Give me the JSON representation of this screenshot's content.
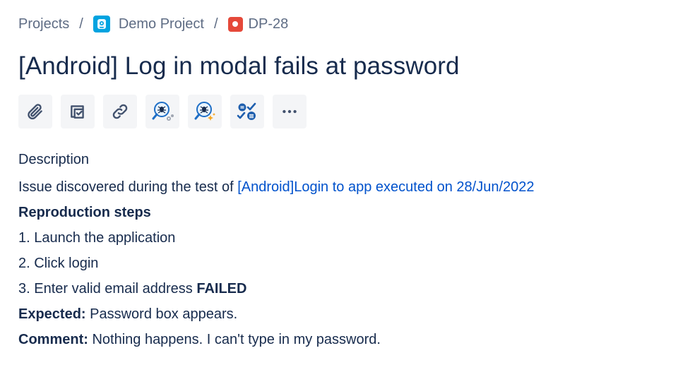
{
  "breadcrumb": {
    "projects": "Projects",
    "separator": "/",
    "project_name": "Demo Project",
    "issue_key": "DP-28"
  },
  "issue": {
    "title": "[Android] Log in modal fails at password"
  },
  "toolbar": {
    "buttons": [
      {
        "name": "attach",
        "icon": "paperclip-icon"
      },
      {
        "name": "add-child-issue",
        "icon": "checkbox-icon"
      },
      {
        "name": "link-issue",
        "icon": "link-icon"
      },
      {
        "name": "bug-search",
        "icon": "bug-search-icon"
      },
      {
        "name": "bug-sparkle",
        "icon": "bug-sparkle-icon"
      },
      {
        "name": "checklist",
        "icon": "checklist-icon"
      },
      {
        "name": "more",
        "icon": "more-icon"
      }
    ]
  },
  "description": {
    "heading": "Description",
    "discovered_prefix": "Issue discovered during the test of ",
    "discovered_link": "[Android]Login to app executed on 28/Jun/2022",
    "repro_heading": "Reproduction steps",
    "step1": "1. Launch the application",
    "step2": "2. Click login",
    "step3": "3. Enter valid email address ",
    "step3_status": "FAILED",
    "expected_label": "Expected:",
    "expected_text": " Password box appears.",
    "comment_label": "Comment:",
    "comment_text": " Nothing happens. I can't type in my password."
  },
  "colors": {
    "text": "#172b4d",
    "muted": "#5e6c84",
    "link": "#0052cc",
    "button_bg": "#f4f5f7",
    "project_avatar": "#00a3e0",
    "bug_type": "#e5493a"
  }
}
